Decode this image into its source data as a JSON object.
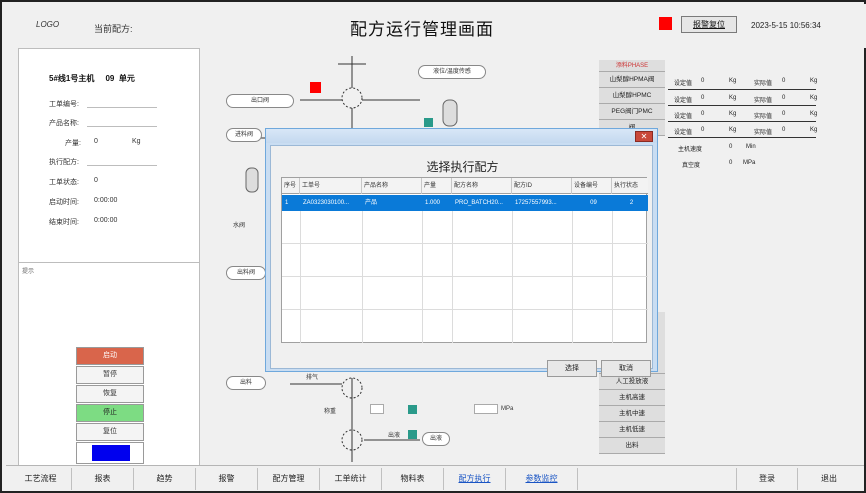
{
  "header": {
    "logo": "LOGO",
    "current_label": "当前配方:",
    "title": "配方运行管理画面",
    "alarm_reset": "报警复位",
    "datetime": "2023-5-15 10:56:34"
  },
  "left_panel": {
    "unit_title": "5#线1号主机",
    "unit_num": "09",
    "unit_suffix": "单元",
    "rows": [
      {
        "label": "工单编号:",
        "value": ""
      },
      {
        "label": "产品名称:",
        "value": ""
      },
      {
        "label": "产量:",
        "value": "0",
        "unit": "Kg"
      },
      {
        "label": "执行配方:",
        "value": ""
      },
      {
        "label": "工单状态:",
        "value": "0"
      },
      {
        "label": "启动时间:",
        "value": "0:00:00"
      },
      {
        "label": "结束时间:",
        "value": "0:00:00"
      }
    ],
    "lower_note": "提示"
  },
  "controls": [
    {
      "label": "启动",
      "style": "start"
    },
    {
      "label": "暂停",
      "style": "normal"
    },
    {
      "label": "恢复",
      "style": "normal"
    },
    {
      "label": "停止",
      "style": "resume"
    },
    {
      "label": "复位",
      "style": "normal"
    }
  ],
  "diagram": {
    "tags": [
      "出口阀",
      "进料阀",
      "出料阀",
      "出料",
      "排气",
      "出液"
    ],
    "labels": [
      "水阀",
      "液位/温度传感",
      "称重"
    ],
    "pressure_unit": "MPa"
  },
  "right_panel": {
    "head": "添料PHASE",
    "items": [
      "山梨醇HPMA阀",
      "山梨醇HPMC",
      "PEG阀门PMC",
      "阀"
    ],
    "lower_items": [
      "人工投放液",
      "主机高速",
      "主机中速",
      "主机低速",
      "出料"
    ],
    "setpoints": [
      {
        "a": "设定值",
        "av": "0",
        "au": "Kg",
        "b": "实际值",
        "bv": "0",
        "bu": "Kg"
      },
      {
        "a": "设定值",
        "av": "0",
        "au": "Kg",
        "b": "实际值",
        "bv": "0",
        "bu": "Kg"
      },
      {
        "a": "设定值",
        "av": "0",
        "au": "Kg",
        "b": "实际值",
        "bv": "0",
        "bu": "Kg"
      },
      {
        "a": "设定值",
        "av": "0",
        "au": "Kg",
        "b": "实际值",
        "bv": "0",
        "bu": "Kg"
      }
    ],
    "motor": {
      "label": "主机速度",
      "value": "0",
      "unit": "Min"
    },
    "pressure": {
      "label": "真空度",
      "value": "0",
      "unit": "MPa"
    }
  },
  "modal": {
    "title": "选择执行配方",
    "columns": [
      "序号",
      "工单号",
      "产品名称",
      "产量",
      "配方名称",
      "配方ID",
      "设备编号",
      "执行状态"
    ],
    "rows": [
      [
        "1",
        "ZA0323030100...",
        "产品",
        "1.000",
        "PRO_BATCH20...",
        "17257557993...",
        "09",
        "2"
      ]
    ],
    "select_btn": "选择",
    "cancel_btn": "取消"
  },
  "nav": {
    "items": [
      "工艺流程",
      "报表",
      "趋势",
      "报警",
      "配方管理",
      "工单统计",
      "物料表",
      "配方执行",
      "参数监控",
      "登录",
      "退出"
    ],
    "active_index": 7
  }
}
